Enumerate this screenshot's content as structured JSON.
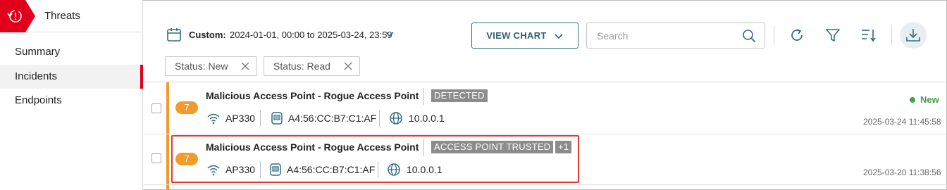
{
  "sidebar": {
    "title": "Threats",
    "items": [
      {
        "label": "Summary",
        "active": false
      },
      {
        "label": "Incidents",
        "active": true
      },
      {
        "label": "Endpoints",
        "active": false
      }
    ]
  },
  "toolbar": {
    "date_label": "Custom:",
    "date_range": "2024-01-01, 00:00 to 2025-03-24, 23:59",
    "view_chart_label": "VIEW CHART",
    "search_placeholder": "Search"
  },
  "filters": [
    {
      "label": "Status: New"
    },
    {
      "label": "Status: Read"
    }
  ],
  "incidents": [
    {
      "severity": "7",
      "title": "Malicious Access Point - Rogue Access Point",
      "tag": "DETECTED",
      "extra_tag": "",
      "ap": "AP330",
      "mac": "A4:56:CC:B7:C1:AF",
      "ip": "10.0.0.1",
      "status": "New",
      "timestamp": "2025-03-24 11:45:58"
    },
    {
      "severity": "7",
      "title": "Malicious Access Point - Rogue Access Point",
      "tag": "ACCESS POINT TRUSTED",
      "extra_tag": "+1",
      "ap": "AP330",
      "mac": "A4:56:CC:B7:C1:AF",
      "ip": "10.0.0.1",
      "status": "",
      "timestamp": "2025-03-20 11:38:56"
    }
  ],
  "colors": {
    "brand_red": "#e0001b",
    "severity_orange": "#f39a2c",
    "status_green": "#43a047",
    "accent_teal": "#2f6d83",
    "highlight_red": "#e53935"
  }
}
